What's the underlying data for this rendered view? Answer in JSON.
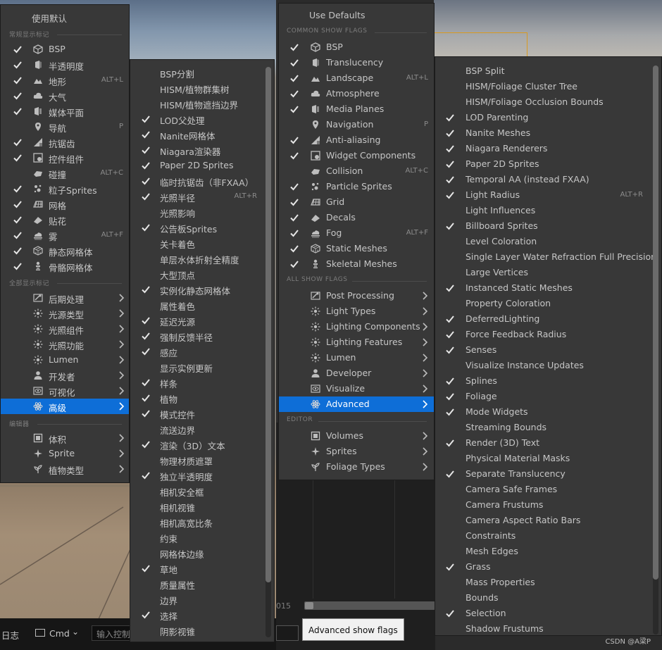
{
  "left_panel": {
    "use_defaults": "使用默认",
    "common_section": "常规显示标记",
    "common_items": [
      {
        "label": "BSP",
        "checked": true,
        "icon": "bsp-cube-icon"
      },
      {
        "label": "半透明度",
        "checked": true,
        "icon": "translucency-icon"
      },
      {
        "label": "地形",
        "checked": true,
        "icon": "landscape-mountain-icon",
        "shortcut": "ALT+L"
      },
      {
        "label": "大气",
        "checked": true,
        "icon": "atmosphere-cloud-icon"
      },
      {
        "label": "媒体平面",
        "checked": true,
        "icon": "media-plane-icon"
      },
      {
        "label": "导航",
        "checked": false,
        "icon": "navigation-pin-icon",
        "shortcut": "P"
      },
      {
        "label": "抗锯齿",
        "checked": true,
        "icon": "anti-aliasing-icon"
      },
      {
        "label": "控件组件",
        "checked": true,
        "icon": "widget-component-icon"
      },
      {
        "label": "碰撞",
        "checked": false,
        "icon": "collision-icon",
        "shortcut": "ALT+C"
      },
      {
        "label": "粒子Sprites",
        "checked": true,
        "icon": "particle-icon"
      },
      {
        "label": "网格",
        "checked": true,
        "icon": "grid-icon"
      },
      {
        "label": "贴花",
        "checked": true,
        "icon": "decal-icon"
      },
      {
        "label": "雾",
        "checked": true,
        "icon": "fog-icon",
        "shortcut": "ALT+F"
      },
      {
        "label": "静态网格体",
        "checked": true,
        "icon": "static-mesh-icon"
      },
      {
        "label": "骨骼网格体",
        "checked": true,
        "icon": "skeletal-mesh-icon"
      }
    ],
    "all_section": "全部显示标记",
    "all_items": [
      {
        "label": "后期处理",
        "icon": "post-process-icon"
      },
      {
        "label": "光源类型",
        "icon": "light-icon"
      },
      {
        "label": "光照组件",
        "icon": "light-icon"
      },
      {
        "label": "光照功能",
        "icon": "light-icon"
      },
      {
        "label": "Lumen",
        "icon": "light-icon"
      },
      {
        "label": "开发者",
        "icon": "developer-icon"
      },
      {
        "label": "可视化",
        "icon": "visualize-eye-icon"
      },
      {
        "label": "高级",
        "icon": "advanced-atom-icon",
        "selected": true
      }
    ],
    "editor_section": "编辑器",
    "editor_items": [
      {
        "label": "体积",
        "icon": "volume-icon"
      },
      {
        "label": "Sprite",
        "icon": "sprite-icon"
      },
      {
        "label": "植物类型",
        "icon": "foliage-icon"
      }
    ],
    "submenu_items": [
      {
        "label": "BSP分割",
        "checked": false
      },
      {
        "label": "HISM/植物群集树",
        "checked": false
      },
      {
        "label": "HISM/植物遮挡边界",
        "checked": false
      },
      {
        "label": "LOD父处理",
        "checked": true
      },
      {
        "label": "Nanite网格体",
        "checked": true
      },
      {
        "label": "Niagara渲染器",
        "checked": true
      },
      {
        "label": "Paper 2D Sprites",
        "checked": true
      },
      {
        "label": "临时抗锯齿（非FXAA）",
        "checked": true
      },
      {
        "label": "光照半径",
        "checked": true,
        "shortcut": "ALT+R"
      },
      {
        "label": "光照影响",
        "checked": false
      },
      {
        "label": "公告板Sprites",
        "checked": true
      },
      {
        "label": "关卡着色",
        "checked": false
      },
      {
        "label": "单层水体折射全精度",
        "checked": false
      },
      {
        "label": "大型顶点",
        "checked": false
      },
      {
        "label": "实例化静态网格体",
        "checked": true
      },
      {
        "label": "属性着色",
        "checked": false
      },
      {
        "label": "延迟光源",
        "checked": true
      },
      {
        "label": "强制反馈半径",
        "checked": true
      },
      {
        "label": "感应",
        "checked": true
      },
      {
        "label": "显示实例更新",
        "checked": false
      },
      {
        "label": "样条",
        "checked": true
      },
      {
        "label": "植物",
        "checked": true
      },
      {
        "label": "模式控件",
        "checked": true
      },
      {
        "label": "流送边界",
        "checked": false
      },
      {
        "label": "渲染（3D）文本",
        "checked": true
      },
      {
        "label": "物理材质遮罩",
        "checked": false
      },
      {
        "label": "独立半透明度",
        "checked": true
      },
      {
        "label": "相机安全框",
        "checked": false
      },
      {
        "label": "相机视锥",
        "checked": false
      },
      {
        "label": "相机高宽比条",
        "checked": false
      },
      {
        "label": "约束",
        "checked": false
      },
      {
        "label": "网格体边缘",
        "checked": false
      },
      {
        "label": "草地",
        "checked": true
      },
      {
        "label": "质量属性",
        "checked": false
      },
      {
        "label": "边界",
        "checked": false
      },
      {
        "label": "选择",
        "checked": true
      },
      {
        "label": "阴影视锥",
        "checked": false
      }
    ],
    "bottom": {
      "log": "日志",
      "cmd": "Cmd",
      "console_placeholder": "输入控制"
    }
  },
  "right_panel": {
    "use_defaults": "Use Defaults",
    "common_section": "COMMON SHOW FLAGS",
    "common_items": [
      {
        "label": "BSP",
        "checked": true,
        "icon": "bsp-cube-icon"
      },
      {
        "label": "Translucency",
        "checked": true,
        "icon": "translucency-icon"
      },
      {
        "label": "Landscape",
        "checked": true,
        "icon": "landscape-mountain-icon",
        "shortcut": "ALT+L"
      },
      {
        "label": "Atmosphere",
        "checked": true,
        "icon": "atmosphere-cloud-icon"
      },
      {
        "label": "Media Planes",
        "checked": true,
        "icon": "media-plane-icon"
      },
      {
        "label": "Navigation",
        "checked": false,
        "icon": "navigation-pin-icon",
        "shortcut": "P"
      },
      {
        "label": "Anti-aliasing",
        "checked": true,
        "icon": "anti-aliasing-icon"
      },
      {
        "label": "Widget Components",
        "checked": true,
        "icon": "widget-component-icon"
      },
      {
        "label": "Collision",
        "checked": false,
        "icon": "collision-icon",
        "shortcut": "ALT+C"
      },
      {
        "label": "Particle Sprites",
        "checked": true,
        "icon": "particle-icon"
      },
      {
        "label": "Grid",
        "checked": true,
        "icon": "grid-icon"
      },
      {
        "label": "Decals",
        "checked": true,
        "icon": "decal-icon"
      },
      {
        "label": "Fog",
        "checked": true,
        "icon": "fog-icon",
        "shortcut": "ALT+F"
      },
      {
        "label": "Static Meshes",
        "checked": true,
        "icon": "static-mesh-icon"
      },
      {
        "label": "Skeletal Meshes",
        "checked": true,
        "icon": "skeletal-mesh-icon"
      }
    ],
    "all_section": "ALL SHOW FLAGS",
    "all_items": [
      {
        "label": "Post Processing",
        "icon": "post-process-icon"
      },
      {
        "label": "Light Types",
        "icon": "light-icon"
      },
      {
        "label": "Lighting Components",
        "icon": "light-icon"
      },
      {
        "label": "Lighting Features",
        "icon": "light-icon"
      },
      {
        "label": "Lumen",
        "icon": "light-icon"
      },
      {
        "label": "Developer",
        "icon": "developer-icon"
      },
      {
        "label": "Visualize",
        "icon": "visualize-eye-icon"
      },
      {
        "label": "Advanced",
        "icon": "advanced-atom-icon",
        "selected": true
      }
    ],
    "editor_section": "EDITOR",
    "editor_items": [
      {
        "label": "Volumes",
        "icon": "volume-icon"
      },
      {
        "label": "Sprites",
        "icon": "sprite-icon"
      },
      {
        "label": "Foliage Types",
        "icon": "foliage-icon"
      }
    ],
    "submenu_items": [
      {
        "label": "BSP Split",
        "checked": false
      },
      {
        "label": "HISM/Foliage Cluster Tree",
        "checked": false
      },
      {
        "label": "HISM/Foliage Occlusion Bounds",
        "checked": false
      },
      {
        "label": "LOD Parenting",
        "checked": true
      },
      {
        "label": "Nanite Meshes",
        "checked": true
      },
      {
        "label": "Niagara Renderers",
        "checked": true
      },
      {
        "label": "Paper 2D Sprites",
        "checked": true
      },
      {
        "label": "Temporal AA (instead FXAA)",
        "checked": true
      },
      {
        "label": "Light Radius",
        "checked": true,
        "shortcut": "ALT+R"
      },
      {
        "label": "Light Influences",
        "checked": false
      },
      {
        "label": "Billboard Sprites",
        "checked": true
      },
      {
        "label": "Level Coloration",
        "checked": false
      },
      {
        "label": "Single Layer Water Refraction Full Precision",
        "checked": false
      },
      {
        "label": "Large Vertices",
        "checked": false
      },
      {
        "label": "Instanced Static Meshes",
        "checked": true
      },
      {
        "label": "Property Coloration",
        "checked": false
      },
      {
        "label": "DeferredLighting",
        "checked": true
      },
      {
        "label": "Force Feedback Radius",
        "checked": true
      },
      {
        "label": "Senses",
        "checked": true
      },
      {
        "label": "Visualize Instance Updates",
        "checked": false
      },
      {
        "label": "Splines",
        "checked": true
      },
      {
        "label": "Foliage",
        "checked": true
      },
      {
        "label": "Mode Widgets",
        "checked": true
      },
      {
        "label": "Streaming Bounds",
        "checked": false
      },
      {
        "label": "Render (3D) Text",
        "checked": true
      },
      {
        "label": "Physical Material Masks",
        "checked": false
      },
      {
        "label": "Separate Translucency",
        "checked": true
      },
      {
        "label": "Camera Safe Frames",
        "checked": false
      },
      {
        "label": "Camera Frustums",
        "checked": false
      },
      {
        "label": "Camera Aspect Ratio Bars",
        "checked": false
      },
      {
        "label": "Constraints",
        "checked": false
      },
      {
        "label": "Mesh Edges",
        "checked": false
      },
      {
        "label": "Grass",
        "checked": true
      },
      {
        "label": "Mass Properties",
        "checked": false
      },
      {
        "label": "Bounds",
        "checked": false
      },
      {
        "label": "Selection",
        "checked": true
      },
      {
        "label": "Shadow Frustums",
        "checked": false
      }
    ],
    "tooltip": "Advanced show flags",
    "frame_partial": "015"
  },
  "watermark": "CSDN @A梁P",
  "colors": {
    "menu_bg": "#383838",
    "selected": "#0e6ed7",
    "check": "#e6e6e6"
  }
}
